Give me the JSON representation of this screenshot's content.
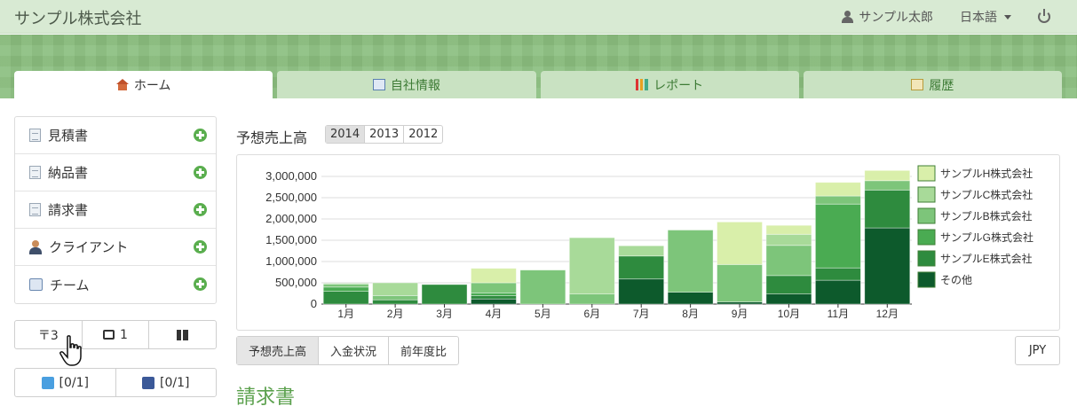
{
  "header": {
    "brand": "サンプル株式会社",
    "user_name": "サンプル太郎",
    "language": "日本語"
  },
  "tabs": [
    {
      "label": "ホーム",
      "icon": "home-icon",
      "active": true
    },
    {
      "label": "自社情報",
      "icon": "org-chart-icon",
      "active": false
    },
    {
      "label": "レポート",
      "icon": "bar-chart-icon",
      "active": false
    },
    {
      "label": "履歴",
      "icon": "history-icon",
      "active": false
    }
  ],
  "sidebar": {
    "items": [
      {
        "label": "見積書",
        "icon": "document-icon"
      },
      {
        "label": "納品書",
        "icon": "document-icon"
      },
      {
        "label": "請求書",
        "icon": "document-icon"
      },
      {
        "label": "クライアント",
        "icon": "person-icon"
      },
      {
        "label": "チーム",
        "icon": "team-icon"
      }
    ],
    "counters": {
      "filter_count": "〒3",
      "inbox_count": "1"
    },
    "social": {
      "twitter": "[0/1]",
      "facebook": "[0/1]"
    }
  },
  "main": {
    "title": "予想売上高",
    "years": [
      "2014",
      "2013",
      "2012"
    ],
    "selected_year": "2014",
    "views": [
      "予想売上高",
      "入金状況",
      "前年度比"
    ],
    "selected_view": "予想売上高",
    "currency": "JPY",
    "section_heading": "請求書"
  },
  "chart_data": {
    "type": "bar",
    "stacked": true,
    "categories": [
      "1月",
      "2月",
      "3月",
      "4月",
      "5月",
      "6月",
      "7月",
      "8月",
      "9月",
      "10月",
      "11月",
      "12月"
    ],
    "ylim": [
      0,
      3000000
    ],
    "yticks": [
      "0",
      "500,000",
      "1,000,000",
      "1,500,000",
      "2,000,000",
      "2,500,000",
      "3,000,000"
    ],
    "ytick_values": [
      0,
      500000,
      1000000,
      1500000,
      2000000,
      2500000,
      3000000
    ],
    "legend_position": "right",
    "series": [
      {
        "name": "その他",
        "color": "#0d5a2c",
        "values": [
          0,
          0,
          0,
          120000,
          0,
          0,
          590000,
          280000,
          50000,
          240000,
          560000,
          1790000
        ]
      },
      {
        "name": "サンプルE株式会社",
        "color": "#2e8b3e",
        "values": [
          300000,
          100000,
          460000,
          80000,
          0,
          0,
          540000,
          0,
          0,
          430000,
          290000,
          890000
        ]
      },
      {
        "name": "サンプルG株式会社",
        "color": "#4aab52",
        "values": [
          100000,
          0,
          0,
          60000,
          0,
          0,
          0,
          0,
          0,
          0,
          1500000,
          0
        ]
      },
      {
        "name": "サンプルB株式会社",
        "color": "#7dc57a",
        "values": [
          70000,
          100000,
          0,
          240000,
          800000,
          240000,
          0,
          1460000,
          880000,
          710000,
          190000,
          220000
        ]
      },
      {
        "name": "サンプルC株式会社",
        "color": "#a8da99",
        "values": [
          20000,
          300000,
          0,
          0,
          0,
          1320000,
          240000,
          0,
          0,
          260000,
          0,
          0
        ]
      },
      {
        "name": "サンプルH株式会社",
        "color": "#d9efaa",
        "values": [
          0,
          0,
          0,
          340000,
          0,
          0,
          0,
          0,
          1000000,
          210000,
          320000,
          240000
        ]
      }
    ]
  }
}
